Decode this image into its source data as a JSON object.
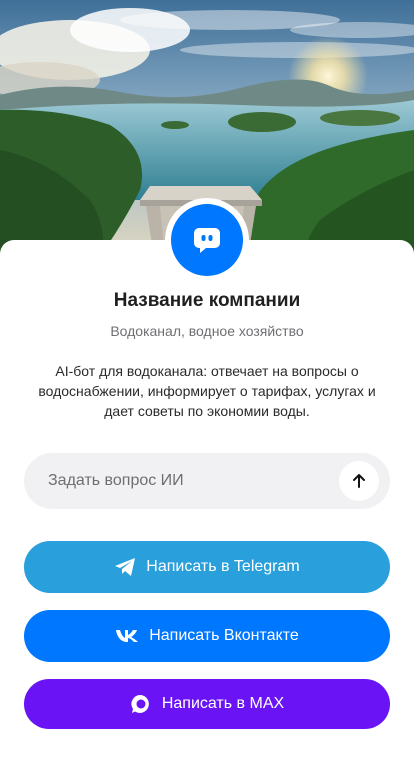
{
  "company": {
    "name": "Название компании",
    "category": "Водоканал, водное хозяйство",
    "description": "AI-бот для водоканала: отвечает на вопросы о водоснабжении, информирует о тарифах, услугах и дает советы по экономии воды."
  },
  "ask": {
    "placeholder": "Задать вопрос ИИ",
    "send_icon": "arrow-up-icon"
  },
  "buttons": {
    "telegram": {
      "label": "Написать в Telegram",
      "icon": "telegram-icon",
      "color": "#29a0dc"
    },
    "vk": {
      "label": "Написать Вконтакте",
      "icon": "vk-icon",
      "color": "#0077ff"
    },
    "max": {
      "label": "Написать в MAX",
      "icon": "max-icon",
      "color": "#6a14f5"
    }
  },
  "colors": {
    "accent": "#0077ff",
    "background": "#ffffff"
  }
}
